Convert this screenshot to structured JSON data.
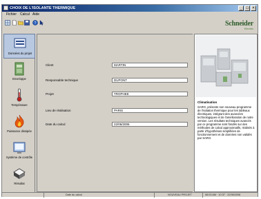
{
  "window": {
    "title": "CHOIX DE L'ISOLANTE THERMIQUE",
    "controls": [
      "_",
      "□",
      "×"
    ]
  },
  "menu": [
    "Fichier",
    "Calcul",
    "Aide"
  ],
  "brand": {
    "name": "Schneider",
    "sub": "Electric"
  },
  "sidebar": {
    "items": [
      {
        "label": "Données du projet",
        "icon": "project-data-icon"
      },
      {
        "label": "Enveloppe",
        "icon": "enclosure-icon"
      },
      {
        "label": "Température",
        "icon": "thermometer-icon"
      },
      {
        "label": "Puissance dissipée",
        "icon": "flame-icon"
      },
      {
        "label": "Système de contrôle",
        "icon": "control-system-icon"
      },
      {
        "label": "Résultat",
        "icon": "result-icon"
      }
    ]
  },
  "form": {
    "fields": [
      {
        "label": "Client",
        "value": "MARTIN"
      },
      {
        "label": "Responsable technique",
        "value": "DUPONT"
      },
      {
        "label": "Projet",
        "value": "TROPHEE"
      },
      {
        "label": "Lieu de réalisation",
        "value": "PARIS"
      },
      {
        "label": "Date du calcul",
        "value": "22/06/2006"
      }
    ]
  },
  "panel": {
    "title": "Climatisation",
    "text": "SARO, présente son nouveau programme de l'isolation thermique pour les tableaux électriques, intégrant des avancées technologiques et de l'amélioration de notre version. Les résultats techniques avancés par ce programme sont fondés sur des méthodes de calcul approximatifs, réalisés à partir d'hypothèses simplifiées de fonctionnement et de données non validés par SARO."
  },
  "status": {
    "left": "",
    "center": "Date du calcul",
    "mode": "NOUVEAU PROJET",
    "time": "06:03 AM · 10:37 · 22/06/2006"
  },
  "colors": {
    "titlebar": "#0a246a",
    "chrome": "#d4d0c8",
    "brand": "#2d5c2a",
    "active_nav": "#b8c8e0"
  }
}
